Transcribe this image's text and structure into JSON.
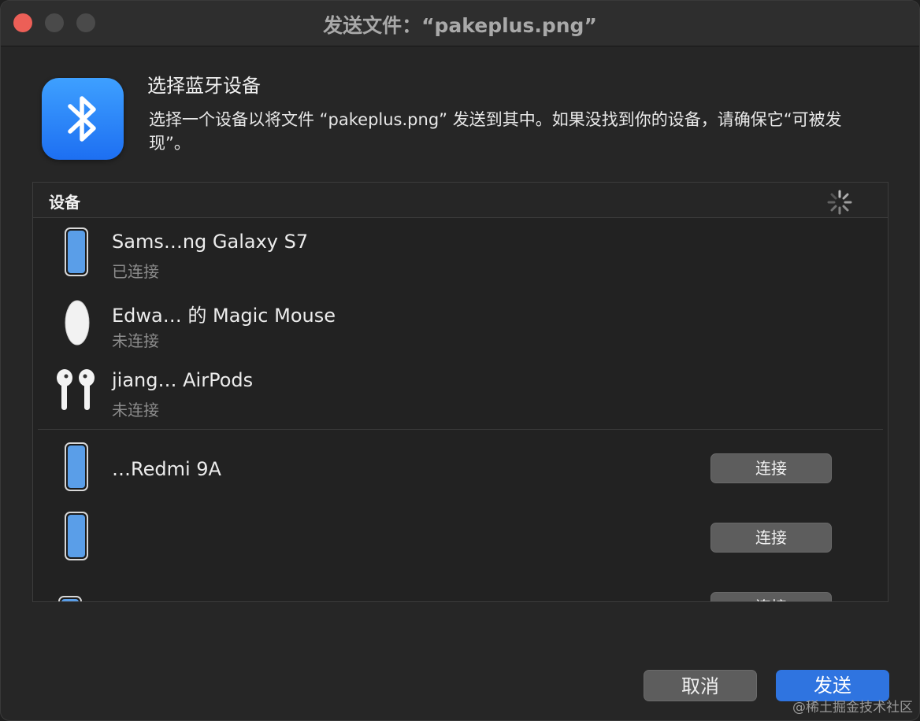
{
  "window": {
    "title": "发送文件：“pakeplus.png”"
  },
  "header": {
    "heading": "选择蓝牙设备",
    "description": "选择一个设备以将文件 “pakeplus.png” 发送到其中。如果没找到你的设备，请确保它“可被发现”。",
    "icon": "bluetooth-icon"
  },
  "table": {
    "column_title": "设备",
    "spinner_icon": "loading-spinner-icon"
  },
  "devices": [
    {
      "name": "Sams…ng Galaxy S7",
      "status": "已连接",
      "icon": "phone-icon"
    },
    {
      "name": "Edwa… 的 Magic Mouse",
      "status": "未连接",
      "icon": "mouse-icon"
    },
    {
      "name": "jiang… AirPods",
      "status": "未连接",
      "icon": "airpods-icon"
    },
    {
      "name": "…Redmi 9A",
      "connect_label": "连接",
      "icon": "phone-icon"
    },
    {
      "name": "",
      "connect_label": "连接",
      "icon": "phone-icon"
    },
    {
      "name": "",
      "connect_label": "连接",
      "icon": "phone-icon"
    }
  ],
  "buttons": {
    "cancel": "取消",
    "send": "发送"
  },
  "watermark": "@稀土掘金技术社区",
  "colors": {
    "accent": "#2f74e0",
    "close": "#ec5f57",
    "bluetooth_top": "#3ea0ff",
    "bluetooth_bottom": "#1d6ff2"
  }
}
